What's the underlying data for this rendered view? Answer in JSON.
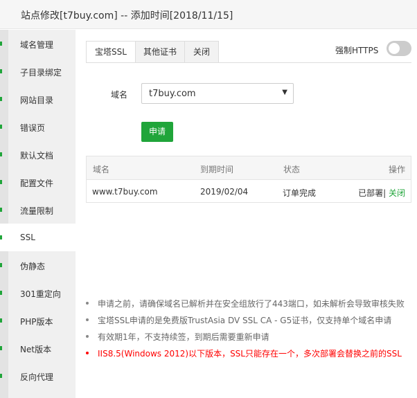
{
  "window": {
    "title": "站点修改[t7buy.com] -- 添加时间[2018/11/15]"
  },
  "sidebar": {
    "items": [
      {
        "label": "域名管理"
      },
      {
        "label": "子目录绑定"
      },
      {
        "label": "网站目录"
      },
      {
        "label": "错误页"
      },
      {
        "label": "默认文档"
      },
      {
        "label": "配置文件"
      },
      {
        "label": "流量限制"
      },
      {
        "label": "SSL"
      },
      {
        "label": "伪静态"
      },
      {
        "label": "301重定向"
      },
      {
        "label": "PHP版本"
      },
      {
        "label": "Net版本"
      },
      {
        "label": "反向代理"
      }
    ],
    "active_item": "SSL"
  },
  "tabs": [
    {
      "label": "宝塔SSL"
    },
    {
      "label": "其他证书"
    },
    {
      "label": "关闭"
    }
  ],
  "active_tab": "宝塔SSL",
  "force_https": {
    "label": "强制HTTPS",
    "enabled": false
  },
  "domain_field": {
    "label": "域名",
    "value": "t7buy.com"
  },
  "apply_button": {
    "label": "申请"
  },
  "table": {
    "headers": [
      "域名",
      "到期时间",
      "状态",
      "操作"
    ],
    "rows": [
      {
        "domain": "www.t7buy.com",
        "expiry": "2019/02/04",
        "status": "订单完成",
        "deployed": "已部署|",
        "close": " 关闭"
      }
    ]
  },
  "notes": [
    {
      "text": "申请之前，请确保域名已解析并在安全组放行了443端口，如未解析会导致审核失败"
    },
    {
      "text": "宝塔SSL申请的是免费版TrustAsia DV SSL CA - G5证书，仅支持单个域名申请"
    },
    {
      "text": "有效期1年，不支持续签，到期后需要重新申请"
    },
    {
      "text": "IIS8.5(Windows 2012)以下版本，SSL只能存在一个，多次部署会替换之前的SSL",
      "warning": true
    }
  ],
  "colors": {
    "accent": "#20a53a",
    "warning": "#ff0000",
    "toggle_off": "#cccccc"
  }
}
